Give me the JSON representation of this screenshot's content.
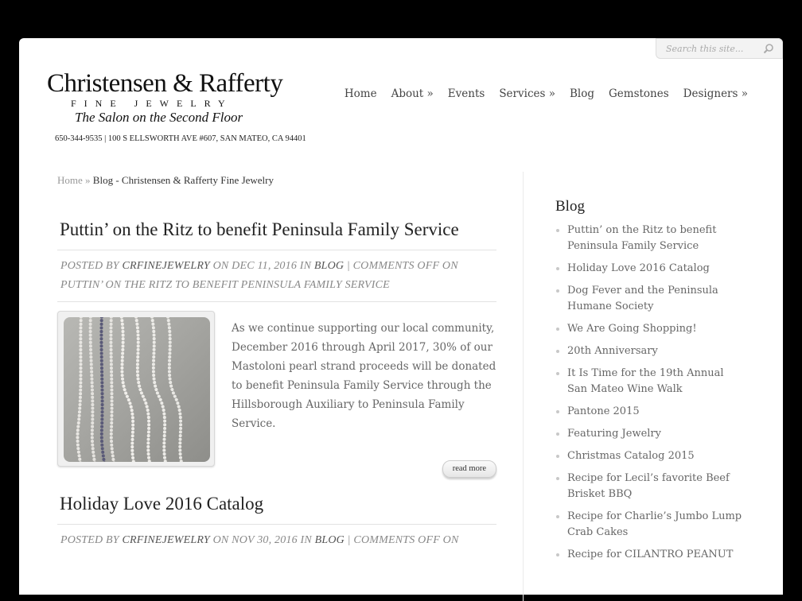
{
  "search": {
    "placeholder": "Search this site..."
  },
  "logo": {
    "line1": "Christensen & Rafferty",
    "line2": "FINE JEWELRY",
    "line3": "The Salon on the Second Floor"
  },
  "address": "650-344-9535 | 100 S ELLSWORTH AVE #607, SAN MATEO, CA 94401",
  "nav": [
    {
      "label": "Home"
    },
    {
      "label": "About »"
    },
    {
      "label": "Events"
    },
    {
      "label": "Services »"
    },
    {
      "label": "Blog"
    },
    {
      "label": "Gemstones"
    },
    {
      "label": "Designers »"
    }
  ],
  "breadcrumb": {
    "home": "Home",
    "sep": "»",
    "current": "Blog - Christensen & Rafferty Fine Jewelry"
  },
  "posts": [
    {
      "title": "Puttin’ on the Ritz to benefit Peninsula Family Service",
      "meta_prefix": "Posted by",
      "author": "crfinejewelry",
      "meta_date": "on Dec 11, 2016 in",
      "category": "Blog",
      "meta_comments": "| Comments Off on Puttin’ on the Ritz to benefit Peninsula Family Service",
      "excerpt": "As we continue supporting our local community, December 2016 through April 2017, 30% of our Mastoloni pearl strand proceeds will be donated to benefit Peninsula Family Service through the Hillsborough Auxiliary to Peninsula Family Service.",
      "read_more": "read more"
    },
    {
      "title": "Holiday Love 2016 Catalog",
      "meta_prefix": "Posted by",
      "author": "crfinejewelry",
      "meta_date": "on Nov 30, 2016 in",
      "category": "Blog",
      "meta_comments": "| Comments Off on"
    }
  ],
  "sidebar": {
    "title": "Blog",
    "items": [
      {
        "label": "Puttin’ on the Ritz to benefit Peninsula Family Service"
      },
      {
        "label": "Holiday Love 2016 Catalog"
      },
      {
        "label": "Dog Fever and the Peninsula Humane Society"
      },
      {
        "label": "We Are Going Shopping!"
      },
      {
        "label": "20th Anniversary"
      },
      {
        "label": "It Is Time for the 19th Annual San Mateo Wine Walk"
      },
      {
        "label": "Pantone 2015"
      },
      {
        "label": "Featuring Jewelry"
      },
      {
        "label": "Christmas Catalog 2015"
      },
      {
        "label": "Recipe for Lecil’s favorite Beef Brisket BBQ"
      },
      {
        "label": "Recipe for Charlie’s Jumbo Lump Crab Cakes"
      },
      {
        "label": "Recipe for CILANTRO PEANUT"
      }
    ]
  }
}
